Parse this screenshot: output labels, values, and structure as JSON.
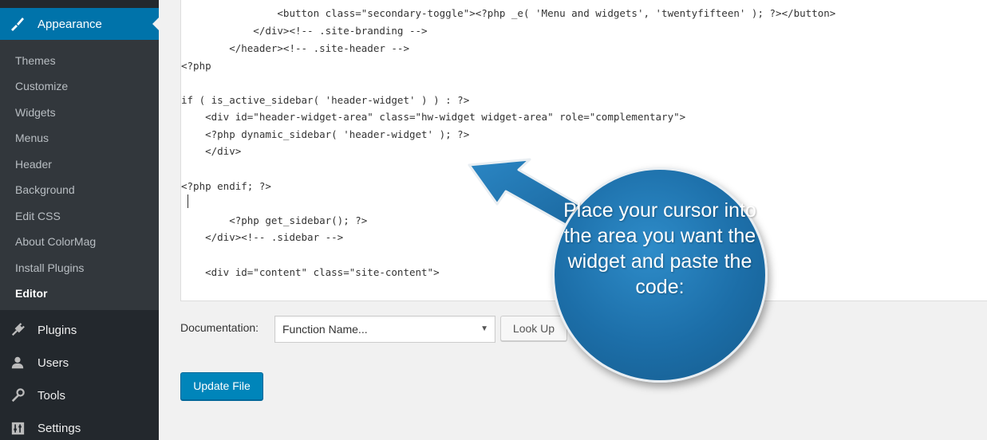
{
  "sidebar": {
    "appearance_label": "Appearance",
    "submenu": [
      "Themes",
      "Customize",
      "Widgets",
      "Menus",
      "Header",
      "Background",
      "Edit CSS",
      "About ColorMag",
      "Install Plugins",
      "Editor"
    ],
    "bottom_items": [
      {
        "label": "Plugins",
        "icon": "plugins-icon"
      },
      {
        "label": "Users",
        "icon": "users-icon"
      },
      {
        "label": "Tools",
        "icon": "tools-icon"
      },
      {
        "label": "Settings",
        "icon": "settings-icon"
      }
    ],
    "current_submenu": "Editor"
  },
  "editor": {
    "lines": [
      "                <button class=\"secondary-toggle\"><?php _e( 'Menu and widgets', 'twentyfifteen' ); ?></button>",
      "            </div><!-- .site-branding -->",
      "        </header><!-- .site-header -->",
      "<?php",
      "",
      "if ( is_active_sidebar( 'header-widget' ) ) : ?>",
      "    <div id=\"header-widget-area\" class=\"hw-widget widget-area\" role=\"complementary\">",
      "    <?php dynamic_sidebar( 'header-widget' ); ?>",
      "    </div>",
      "",
      "<?php endif; ?>",
      "",
      "        <?php get_sidebar(); ?>",
      "    </div><!-- .sidebar -->",
      "",
      "    <div id=\"content\" class=\"site-content\">"
    ]
  },
  "documentation": {
    "label": "Documentation:",
    "select_value": "Function Name...",
    "lookup_label": "Look Up"
  },
  "update_button": "Update File",
  "annotation": {
    "text": "Place your cursor into the area you want the widget and paste the code:"
  },
  "colors": {
    "sidebar_bg": "#23282d",
    "submenu_bg": "#32373c",
    "active_blue": "#0073aa",
    "primary_button": "#0085ba",
    "callout_blue": "#1c6ea8"
  }
}
